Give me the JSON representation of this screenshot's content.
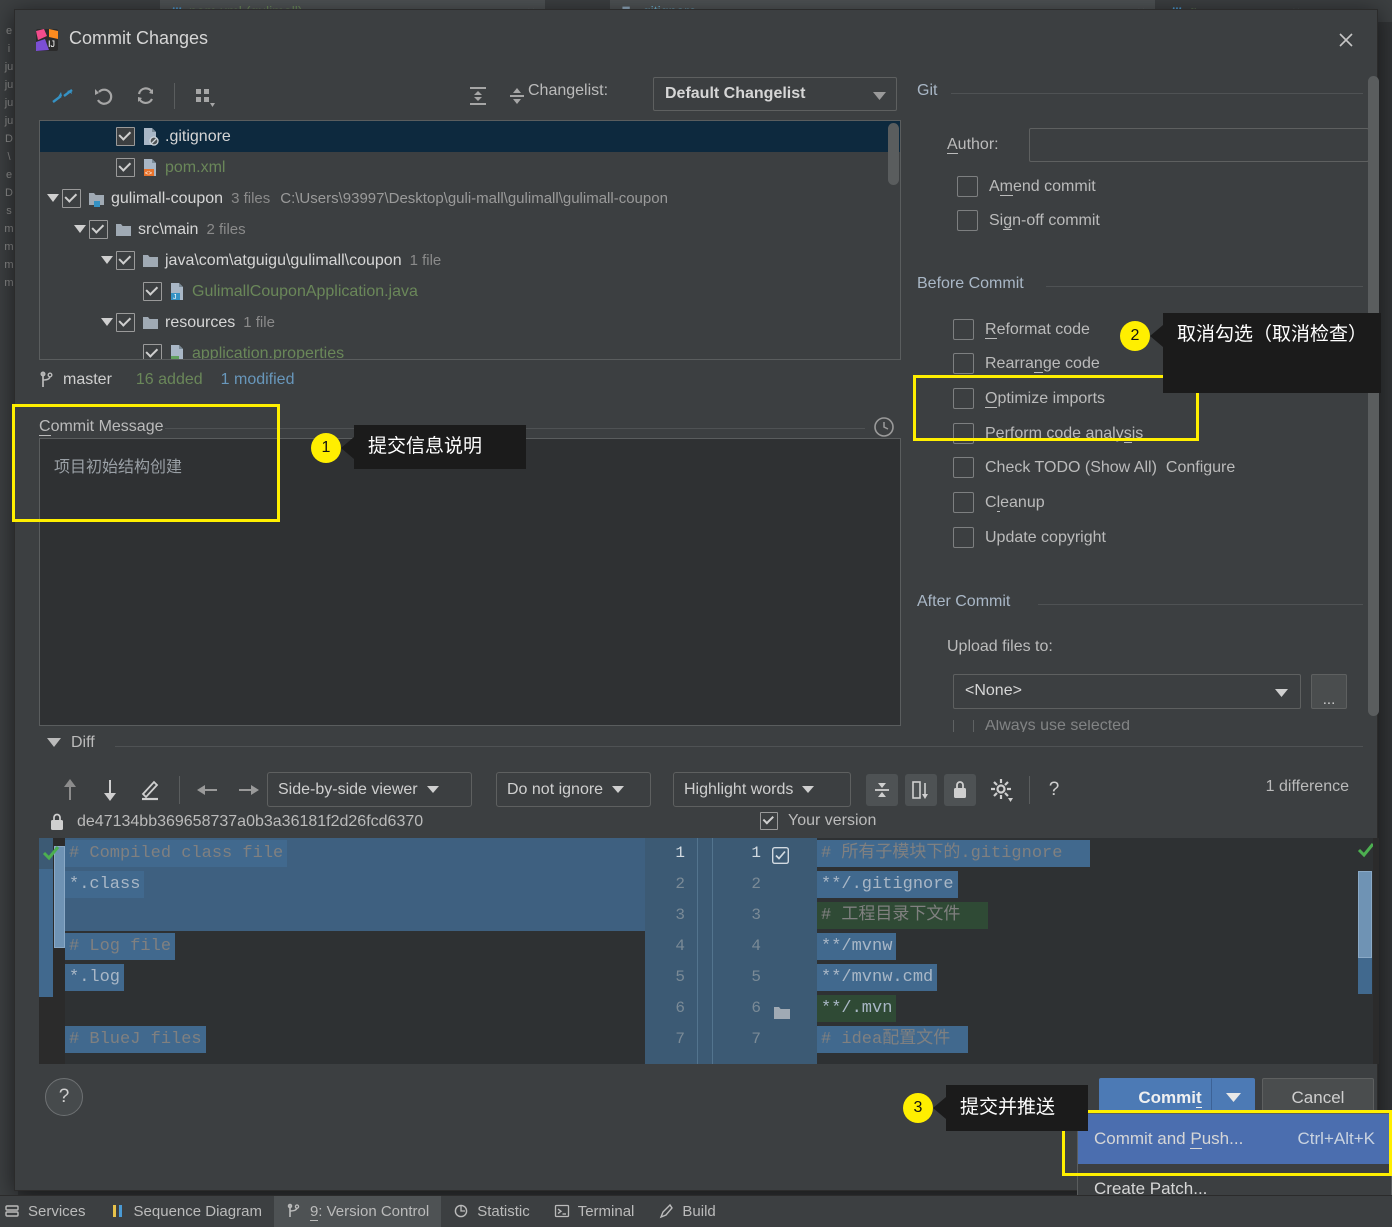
{
  "background": {
    "tabs": [
      {
        "label": "pom.xml (gulimall)",
        "close": "×",
        "icon": "maven-icon"
      },
      {
        "label": ".gitignore",
        "close": "×",
        "icon": "gitignore-icon"
      },
      {
        "label": "g",
        "close": "×",
        "icon": "file-icon"
      }
    ],
    "left_strip": "e i ju ju ju ju D \\ e D s m m m m"
  },
  "dialog": {
    "title": "Commit Changes",
    "close_label": "✕",
    "toolbar": {
      "buttons": [
        {
          "name": "show-diff-icon",
          "tip": "Show Diff"
        },
        {
          "name": "revert-icon",
          "tip": "Revert"
        },
        {
          "name": "refresh-icon",
          "tip": "Refresh Changes"
        },
        {
          "name": "group-by-icon",
          "tip": "Group By"
        },
        {
          "name": "expand-all-icon",
          "tip": "Expand All"
        },
        {
          "name": "collapse-all-icon",
          "tip": "Collapse All"
        }
      ],
      "changelist_label": "Changelist:",
      "changelist_value": "Default Changelist"
    },
    "tree": [
      {
        "indent": 2,
        "checked": true,
        "twisty": "",
        "icon": "gitignore-file-icon",
        "name": ".gitignore",
        "color": "white",
        "meta": "",
        "path": "",
        "selected": true
      },
      {
        "indent": 2,
        "checked": true,
        "twisty": "",
        "icon": "xml-file-icon",
        "name": "pom.xml",
        "color": "green",
        "meta": "",
        "path": "",
        "selected": false
      },
      {
        "indent": 0,
        "checked": true,
        "twisty": "down",
        "icon": "module-folder-icon",
        "name": "gulimall-coupon",
        "color": "white",
        "meta": "3 files",
        "path": "C:\\Users\\93997\\Desktop\\guli-mall\\gulimall\\gulimall-coupon",
        "selected": false
      },
      {
        "indent": 1,
        "checked": true,
        "twisty": "down",
        "icon": "folder-icon",
        "name": "src\\main",
        "color": "white",
        "meta": "2 files",
        "path": "",
        "selected": false
      },
      {
        "indent": 2,
        "checked": true,
        "twisty": "down",
        "icon": "folder-icon",
        "name": "java\\com\\atguigu\\gulimall\\coupon",
        "color": "white",
        "meta": "1 file",
        "path": "",
        "selected": false
      },
      {
        "indent": 3,
        "checked": true,
        "twisty": "",
        "icon": "java-file-icon",
        "name": "GulimallCouponApplication.java",
        "color": "green",
        "meta": "",
        "path": "",
        "selected": false
      },
      {
        "indent": 2,
        "checked": true,
        "twisty": "down",
        "icon": "folder-icon",
        "name": "resources",
        "color": "white",
        "meta": "1 file",
        "path": "",
        "selected": false
      },
      {
        "indent": 3,
        "checked": true,
        "twisty": "",
        "icon": "properties-file-icon",
        "name": "application.properties",
        "color": "green",
        "meta": "",
        "path": "",
        "selected": false
      }
    ],
    "branch_bar": {
      "branch": "master",
      "added": "16 added",
      "modified": "1 modified"
    },
    "commit_message": {
      "legend": "Commit Message",
      "legend_mnemonic": "C",
      "value": "项目初始结构创建",
      "history_icon": "clock-icon"
    },
    "git_group": {
      "legend": "Git",
      "author_label": "Author:",
      "author_mnemonic": "A",
      "author_value": "",
      "checkboxes": [
        {
          "label": "Amend commit",
          "mnemonic": "m",
          "checked": false
        },
        {
          "label": "Sign-off commit",
          "mnemonic": "g",
          "checked": false
        }
      ]
    },
    "before_commit": {
      "legend": "Before Commit",
      "checkboxes": [
        {
          "label": "Reformat code",
          "mnemonic": "R",
          "checked": false,
          "link": ""
        },
        {
          "label": "Rearrange code",
          "mnemonic": "n",
          "checked": false,
          "link": ""
        },
        {
          "label": "Optimize imports",
          "mnemonic": "O",
          "checked": false,
          "link": ""
        },
        {
          "label": "Perform code analysis",
          "mnemonic": "s",
          "checked": false,
          "link": ""
        },
        {
          "label": "Check TODO (Show All)",
          "mnemonic": "",
          "checked": false,
          "link": "Configure"
        },
        {
          "label": "Cleanup",
          "mnemonic": "l",
          "checked": false,
          "link": ""
        },
        {
          "label": "Update copyright",
          "mnemonic": "",
          "checked": false,
          "link": ""
        }
      ]
    },
    "after_commit": {
      "legend": "After Commit",
      "upload_label": "Upload files to:",
      "upload_value": "<None>",
      "browse_label": "..."
    },
    "diff": {
      "section_label": "Diff",
      "toolbar": {
        "viewer_mode": "Side-by-side viewer",
        "ignore_mode": "Do not ignore",
        "highlight_mode": "Highlight words",
        "help_label": "?",
        "difference_count": "1 difference"
      },
      "left_revision": "de47134bb369658737a0b3a36181f2d26fcd6370",
      "right_revision": "Your version",
      "left_lines": [
        {
          "text": "# Compiled class file",
          "kind": "comment",
          "bg": "changed"
        },
        {
          "text": "*.class",
          "kind": "code",
          "bg": "changed"
        },
        {
          "text": "",
          "kind": "code",
          "bg": "changed"
        },
        {
          "text": "# Log file",
          "kind": "comment",
          "bg": "partial"
        },
        {
          "text": "*.log",
          "kind": "code",
          "bg": "partial"
        },
        {
          "text": "",
          "kind": "code",
          "bg": "none"
        },
        {
          "text": "# BlueJ files",
          "kind": "comment",
          "bg": "partial"
        }
      ],
      "right_line_numbers_left": [
        "1",
        "2",
        "3",
        "4",
        "5",
        "6",
        "7"
      ],
      "right_line_numbers_right": [
        "1",
        "2",
        "3",
        "4",
        "5",
        "6",
        "7"
      ],
      "right_lines": [
        {
          "text": "# 所有子模块下的.gitignore",
          "kind": "comment",
          "bg": "changed"
        },
        {
          "text": "**/.gitignore",
          "kind": "code",
          "bg": "changed"
        },
        {
          "text": "# 工程目录下文件",
          "kind": "comment",
          "bg": "added"
        },
        {
          "text": "**/mvnw",
          "kind": "code",
          "bg": "changed"
        },
        {
          "text": "**/mvnw.cmd",
          "kind": "code",
          "bg": "changed"
        },
        {
          "text": "**/.mvn",
          "kind": "code",
          "bg": "added"
        },
        {
          "text": "# idea配置文件",
          "kind": "comment",
          "bg": "changed"
        }
      ]
    },
    "footer": {
      "help_label": "?",
      "commit_label": "Commit",
      "commit_mnemonic": "t",
      "cancel_label": "Cancel"
    },
    "popup_menu": [
      {
        "label": "Commit and Push...",
        "mnemonic": "P",
        "shortcut": "Ctrl+Alt+K",
        "highlighted": true
      },
      {
        "label": "Create Patch...",
        "mnemonic": "",
        "shortcut": "",
        "highlighted": false
      }
    ]
  },
  "annotations": [
    {
      "number": "1",
      "text": "提交信息说明"
    },
    {
      "number": "2",
      "text": "取消勾选（取消检查）"
    },
    {
      "number": "3",
      "text": "提交并推送"
    }
  ],
  "status_bar": [
    {
      "label": "Services",
      "icon": "services-icon",
      "active": false,
      "mnemonic": ""
    },
    {
      "label": "Sequence Diagram",
      "icon": "sequence-icon",
      "active": false,
      "mnemonic": ""
    },
    {
      "label": "9: Version Control",
      "icon": "vcs-icon",
      "active": true,
      "mnemonic": "9"
    },
    {
      "label": "Statistic",
      "icon": "statistic-icon",
      "active": false,
      "mnemonic": ""
    },
    {
      "label": "Terminal",
      "icon": "terminal-icon",
      "active": false,
      "mnemonic": ""
    },
    {
      "label": "Build",
      "icon": "build-icon",
      "active": false,
      "mnemonic": ""
    }
  ],
  "colors": {
    "accent": "#4c7ab5",
    "highlight": "#ffef00",
    "added_text": "#6a8759",
    "modified_text": "#6897bb",
    "link": "#589df6",
    "selection": "#0d293e"
  }
}
